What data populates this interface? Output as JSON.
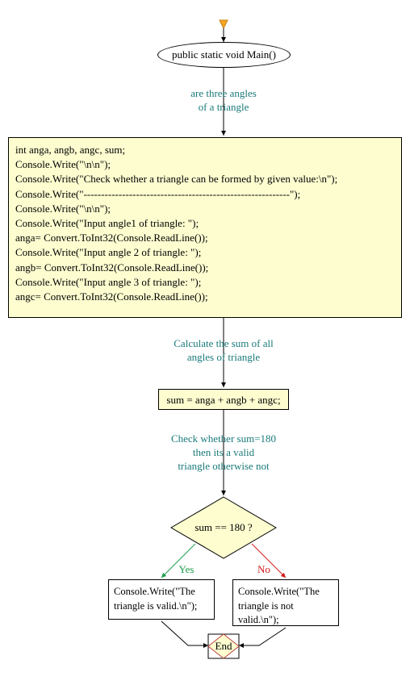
{
  "start": {
    "label": "public static void Main()"
  },
  "edges": {
    "e1": "are three angles\nof a triangle",
    "e2": "Calculate the sum of all\nangles of triangle",
    "e3": "Check whether sum=180\nthen its a valid\ntriangle otherwise not",
    "yes": "Yes",
    "no": "No"
  },
  "code_block": "int anga, angb, angc, sum;\nConsole.Write(\"\\n\\n\");\nConsole.Write(\"Check whether a triangle can be formed by given value:\\n\");\nConsole.Write(\"-----------------------------------------------------------\");\nConsole.Write(\"\\n\\n\");\nConsole.Write(\"Input angle1 of triangle: \");\nanga= Convert.ToInt32(Console.ReadLine());\nConsole.Write(\"Input angle 2 of triangle: \");\nangb= Convert.ToInt32(Console.ReadLine());\nConsole.Write(\"Input angle 3 of triangle: \");\nangc= Convert.ToInt32(Console.ReadLine());",
  "sum_expr": "sum = anga + angb + angc;",
  "decision": "sum == 180 ?",
  "result_yes": "Console.Write(\"The\ntriangle is valid.\\n\");",
  "result_no": "Console.Write(\"The\ntriangle is not\nvalid.\\n\");",
  "end": "End"
}
